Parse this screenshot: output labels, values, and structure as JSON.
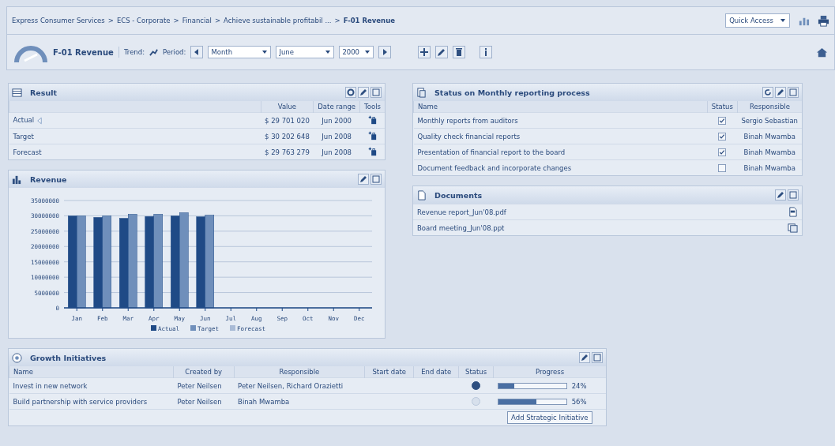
{
  "breadcrumb": {
    "separator": ">",
    "items": [
      "Express Consumer Services",
      "ECS - Corporate",
      "Financial",
      "Achieve sustainable profitabil ...",
      "F-01 Revenue"
    ],
    "quick_access": "Quick Access"
  },
  "toolbar": {
    "title": "F-01 Revenue",
    "trend_label": "Trend:",
    "period_label": "Period:",
    "period_type": "Month",
    "month": "June",
    "year": "2000"
  },
  "result": {
    "title": "Result",
    "columns": [
      "Value",
      "Date range",
      "Tools"
    ],
    "rows": [
      {
        "name": "Actual",
        "value": "$ 29 701 020",
        "date_range": "Jun 2000",
        "indicator": true
      },
      {
        "name": "Target",
        "value": "$ 30 202 648",
        "date_range": "Jun 2008",
        "indicator": false
      },
      {
        "name": "Forecast",
        "value": "$ 29 763 279",
        "date_range": "Jun 2008",
        "indicator": false
      }
    ]
  },
  "status": {
    "title": "Status on Monthly reporting process",
    "columns": [
      "Name",
      "Status",
      "Responsible"
    ],
    "rows": [
      {
        "name": "Monthly reports from auditors",
        "checked": true,
        "responsible": "Sergio Sebastian"
      },
      {
        "name": "Quality check financial reports",
        "checked": true,
        "responsible": "Binah Mwamba"
      },
      {
        "name": "Presentation of financial report to the board",
        "checked": true,
        "responsible": "Binah Mwamba"
      },
      {
        "name": "Document feedback and incorporate changes",
        "checked": false,
        "responsible": "Binah Mwamba"
      }
    ]
  },
  "revenue": {
    "title": "Revenue",
    "chart_data": {
      "type": "bar",
      "categories": [
        "Jan",
        "Feb",
        "Mar",
        "Apr",
        "May",
        "Jun",
        "Jul",
        "Aug",
        "Sep",
        "Oct",
        "Nov",
        "Dec"
      ],
      "series": [
        {
          "name": "Actual",
          "color": "#1f4a86",
          "values": [
            30000000,
            29500000,
            29200000,
            29800000,
            30000000,
            29700000,
            null,
            null,
            null,
            null,
            null,
            null
          ]
        },
        {
          "name": "Target",
          "color": "#6f8fbb",
          "values": [
            30000000,
            30000000,
            30500000,
            30500000,
            31000000,
            30200000,
            null,
            null,
            null,
            null,
            null,
            null
          ]
        },
        {
          "name": "Forecast",
          "color": "#a9bbd6",
          "values": [
            null,
            null,
            null,
            null,
            null,
            null,
            null,
            null,
            null,
            null,
            null,
            null
          ]
        }
      ],
      "ylim": [
        0,
        35000000
      ],
      "yticks": [
        0,
        5000000,
        10000000,
        15000000,
        20000000,
        25000000,
        30000000,
        35000000
      ],
      "grid": true,
      "legend": true
    }
  },
  "documents": {
    "title": "Documents",
    "items": [
      {
        "name": "Revenue report_Jun'08.pdf",
        "kind": "pdf"
      },
      {
        "name": "Board meeting_Jun'08.ppt",
        "kind": "ppt"
      }
    ]
  },
  "growth": {
    "title": "Growth Initiatives",
    "columns": [
      "Name",
      "Created by",
      "Responsible",
      "Start date",
      "End date",
      "Status",
      "Progress"
    ],
    "rows": [
      {
        "name": "Invest in new network",
        "created_by": "Peter Neilsen",
        "responsible": "Peter Neilsen, Richard Orazietti",
        "status_active": true,
        "level": 0.24,
        "progress": "24%"
      },
      {
        "name": "Build partnership with service providers",
        "created_by": "Peter Neilsen",
        "responsible": "Binah Mwamba",
        "status_active": false,
        "level": 0.56,
        "progress": "56%"
      }
    ],
    "add_button": "Add Strategic Initiative"
  }
}
